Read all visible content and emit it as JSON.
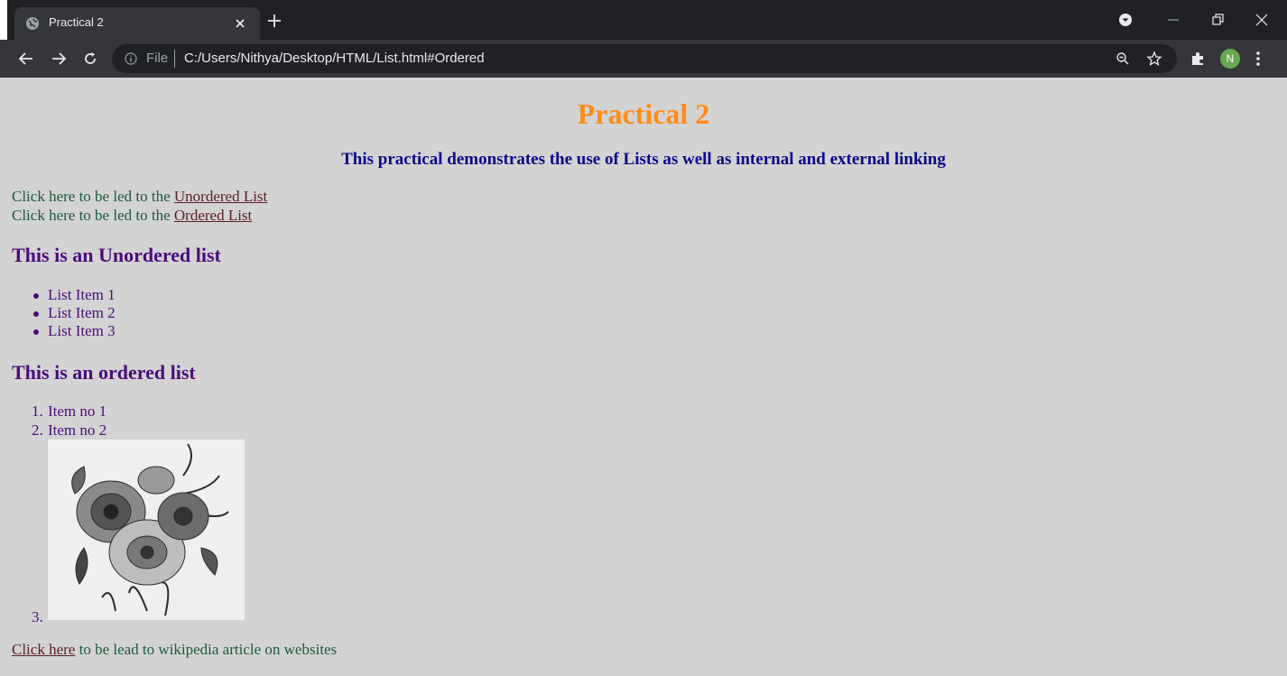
{
  "browser": {
    "tab_title": "Practical 2",
    "omnibox_scheme": "File",
    "url": "C:/Users/Nithya/Desktop/HTML/List.html#Ordered",
    "avatar_initial": "N"
  },
  "page": {
    "heading": "Practical 2",
    "subtitle": "This practical demonstrates the use of Lists as well as internal and external linking",
    "nav_lines": [
      {
        "prefix": "Click here to be led to the ",
        "link": "Unordered List"
      },
      {
        "prefix": "Click here to be led to the ",
        "link": "Ordered List"
      }
    ],
    "unordered_heading": "This is an Unordered list",
    "unordered_items": [
      "List Item 1",
      "List Item 2",
      "List Item 3"
    ],
    "ordered_heading": "This is an ordered list",
    "ordered_items": [
      "Item no 1",
      "Item no 2"
    ],
    "ordered_markers": [
      "1.",
      "2.",
      "3."
    ],
    "footer_link": "Click here",
    "footer_text": " to be lead to wikipedia article on websites"
  },
  "colors": {
    "background": "#d3d3d3",
    "heading": "#ff8c1a",
    "subtitle": "#0b0b8a",
    "green_text": "#1e5a3c",
    "link": "#5a1f26",
    "purple": "#4b0d7a"
  }
}
